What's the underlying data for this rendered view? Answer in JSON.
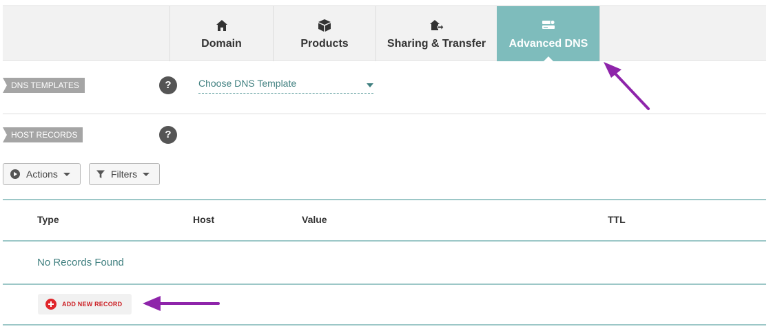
{
  "tabs": [
    {
      "label": "Domain",
      "icon": "home-icon",
      "active": false
    },
    {
      "label": "Products",
      "icon": "box-icon",
      "active": false
    },
    {
      "label": "Sharing & Transfer",
      "icon": "house-transfer-icon",
      "active": false
    },
    {
      "label": "Advanced DNS",
      "icon": "server-icon",
      "active": true
    }
  ],
  "dns_templates": {
    "label": "DNS TEMPLATES",
    "help": "?",
    "select_value": "Choose DNS Template"
  },
  "host_records": {
    "label": "HOST RECORDS",
    "help": "?"
  },
  "toolbar": {
    "actions_label": "Actions",
    "filters_label": "Filters"
  },
  "table": {
    "columns": [
      "Type",
      "Host",
      "Value",
      "TTL"
    ],
    "empty_text": "No Records Found"
  },
  "add_record_label": "ADD NEW RECORD",
  "colors": {
    "active_tab": "#7ebcbc",
    "accent_teal": "#3f7f7f",
    "annotation_arrow": "#8e24aa",
    "add_red": "#e0262b"
  }
}
